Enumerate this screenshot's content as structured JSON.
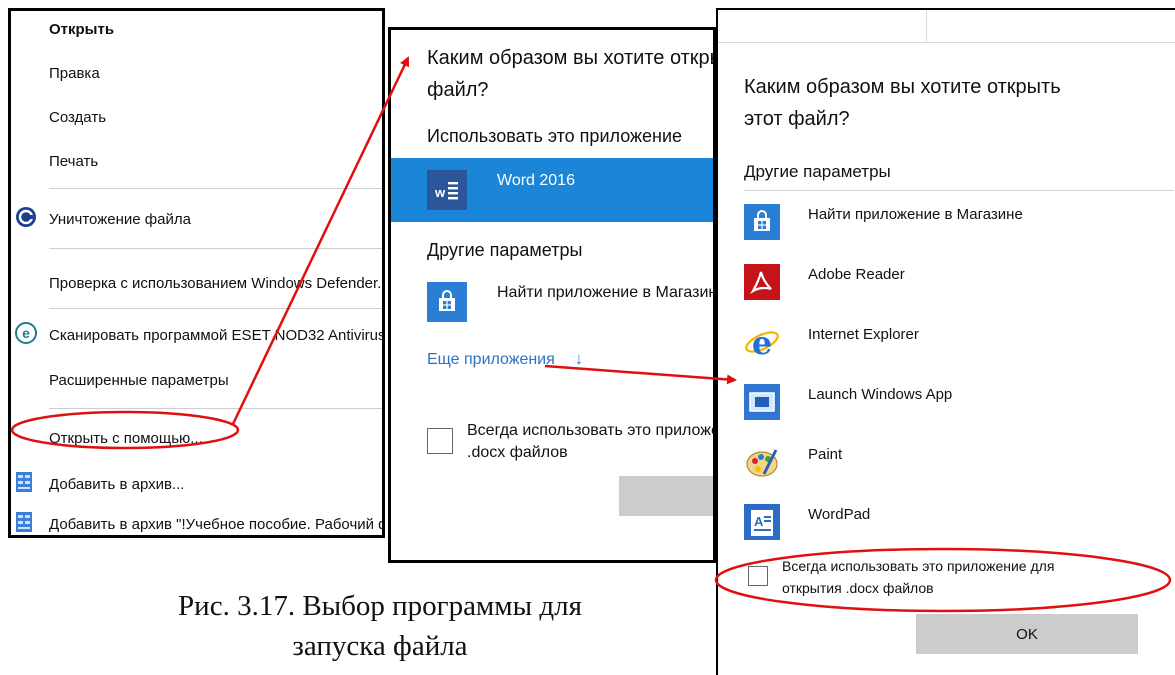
{
  "context_menu": {
    "items": [
      {
        "label": "Открыть"
      },
      {
        "label": "Правка"
      },
      {
        "label": "Создать"
      },
      {
        "label": "Печать"
      },
      {
        "label": "Уничтожение файла",
        "icon": "shred-icon"
      },
      {
        "label": "Проверка с использованием Windows Defender..."
      },
      {
        "label": "Сканировать программой ESET NOD32 Antivirus",
        "icon": "eset-icon"
      },
      {
        "label": "Расширенные параметры"
      },
      {
        "label": "Открыть с помощью..."
      },
      {
        "label": "Добавить в архив...",
        "icon": "winrar-icon"
      },
      {
        "label": "Добавить в архив \"!Учебное пособие. Рабочий файл.rar\"",
        "icon": "winrar-icon"
      }
    ]
  },
  "dialog_small": {
    "title": "Каким образом вы хотите открыть этот файл?",
    "use_this_app": "Использовать это приложение",
    "word_app": "Word 2016",
    "other_options": "Другие параметры",
    "store_app": "Найти приложение в Магазине",
    "more_apps": "Еще приложения",
    "always_use": "Всегда использовать это приложение для открытия .docx файлов"
  },
  "dialog_large": {
    "title_line1": "Каким образом вы хотите открыть",
    "title_line2": "этот файл?",
    "other_options": "Другие параметры",
    "apps": [
      {
        "label": "Найти приложение в Магазине",
        "icon": "store-icon"
      },
      {
        "label": "Adobe Reader",
        "icon": "adobe-reader-icon"
      },
      {
        "label": "Internet Explorer",
        "icon": "internet-explorer-icon"
      },
      {
        "label": "Launch Windows App",
        "icon": "windows-app-icon"
      },
      {
        "label": "Paint",
        "icon": "paint-icon"
      },
      {
        "label": "WordPad",
        "icon": "wordpad-icon"
      }
    ],
    "always_use_line1": "Всегда использовать это приложение для",
    "always_use_line2": "открытия .docx файлов",
    "ok_label": "OK"
  },
  "caption": {
    "line1": "Рис. 3.17. Выбор программы для",
    "line2": "запуска файла"
  },
  "colors": {
    "accent_blue": "#0078d7",
    "annotation_red": "#e01010",
    "button_gray": "#cccccc"
  }
}
